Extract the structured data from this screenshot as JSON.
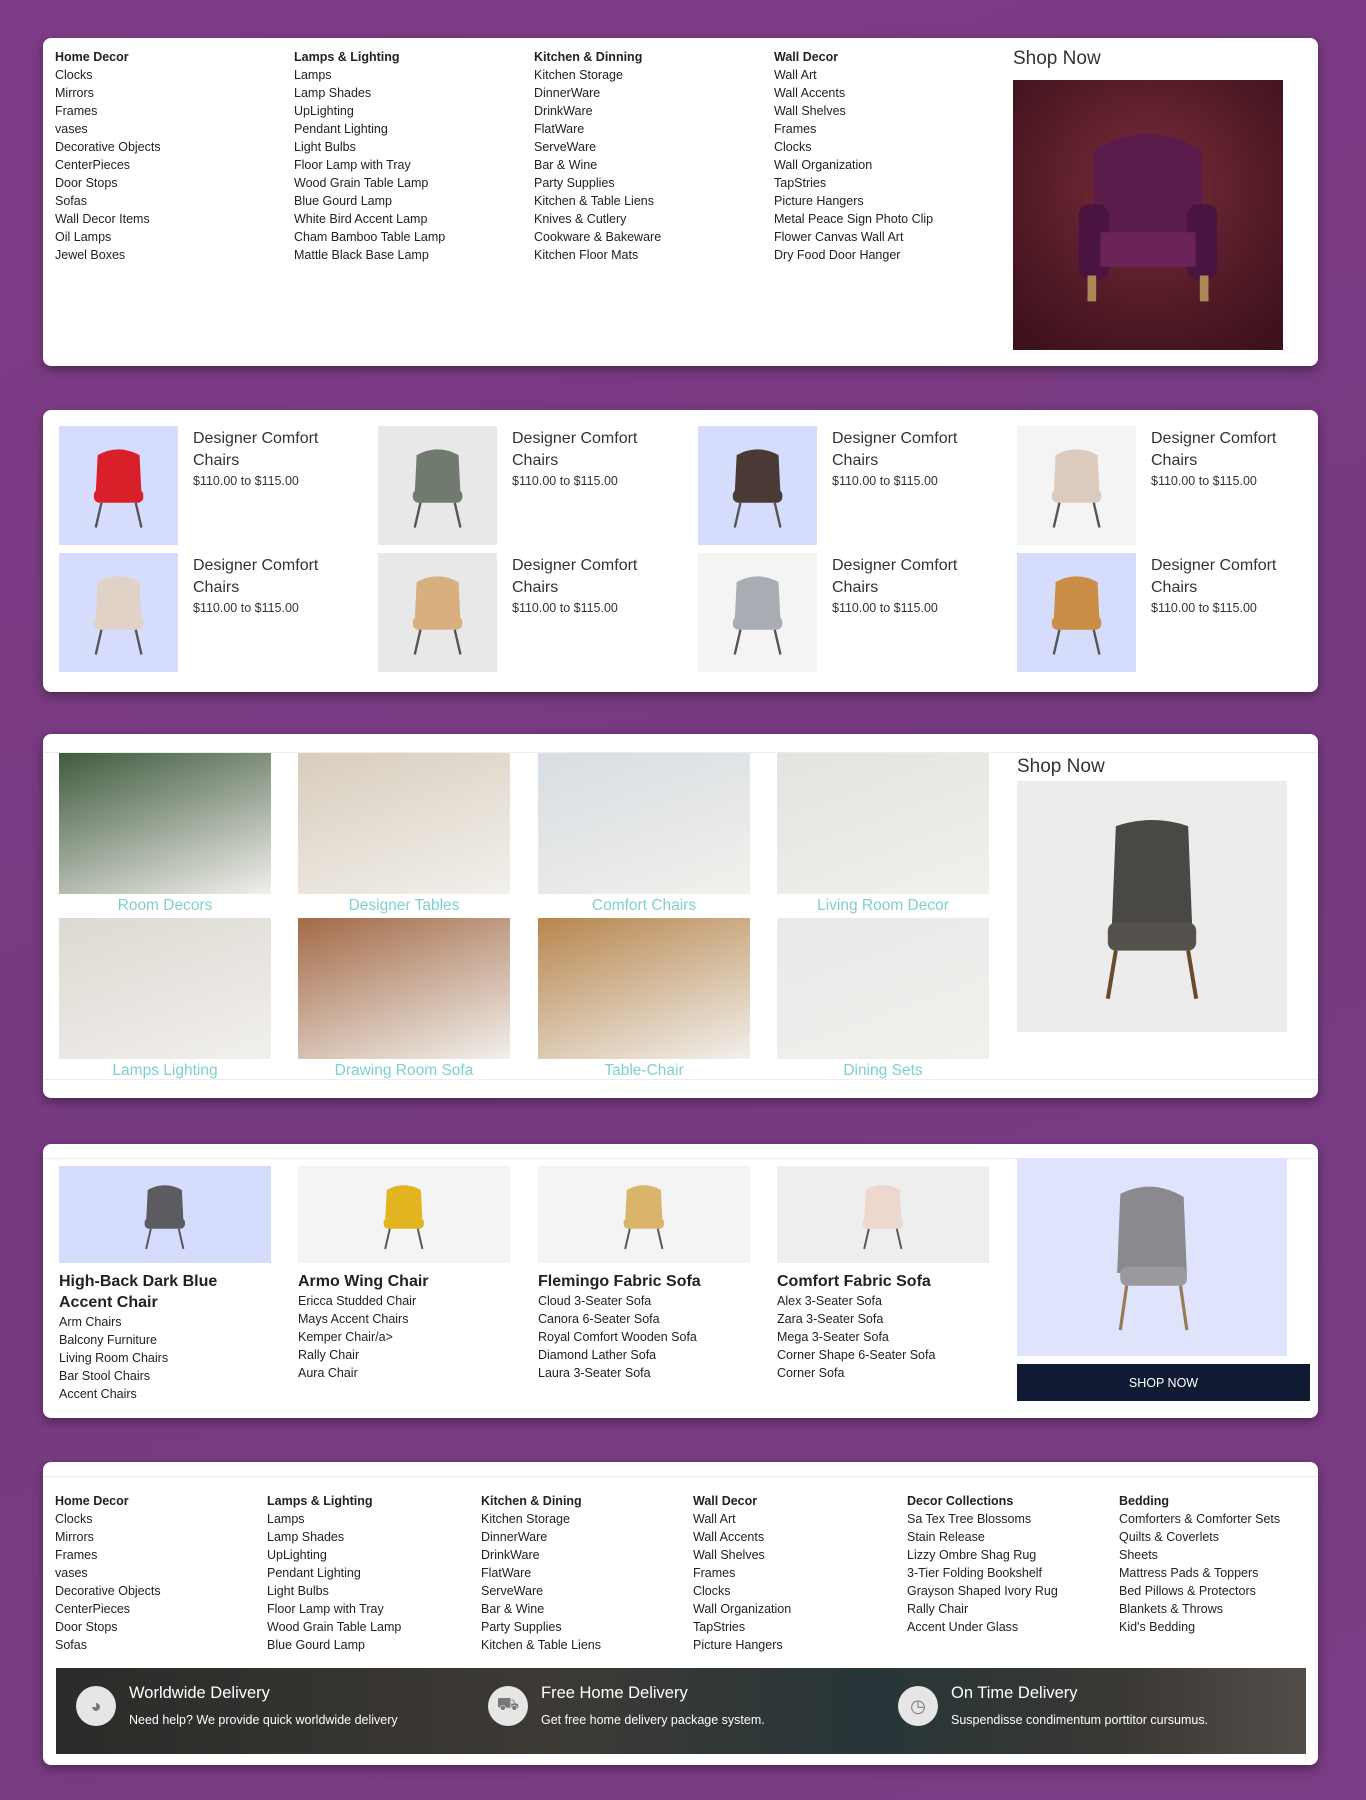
{
  "menu": {
    "columns": [
      {
        "title": "Home Decor",
        "items": [
          "Clocks",
          "Mirrors",
          "Frames",
          "vases",
          "Decorative Objects",
          "CenterPieces",
          "Door Stops",
          "Sofas",
          "Wall Decor Items",
          "Oil Lamps",
          "Jewel Boxes"
        ]
      },
      {
        "title": "Lamps & Lighting",
        "items": [
          "Lamps",
          "Lamp Shades",
          "UpLighting",
          "Pendant Lighting",
          "Light Bulbs",
          "Floor Lamp with Tray",
          "Wood Grain Table Lamp",
          "Blue Gourd Lamp",
          "White Bird Accent Lamp",
          "Cham Bamboo Table Lamp",
          "Mattle Black Base Lamp"
        ]
      },
      {
        "title": "Kitchen & Dinning",
        "items": [
          "Kitchen Storage",
          "DinnerWare",
          "DrinkWare",
          "FlatWare",
          "ServeWare",
          "Bar & Wine",
          "Party Supplies",
          "Kitchen & Table Liens",
          "Knives & Cutlery",
          "Cookware & Bakeware",
          "Kitchen Floor Mats"
        ]
      },
      {
        "title": "Wall Decor",
        "items": [
          "Wall Art",
          "Wall Accents",
          "Wall Shelves",
          "Frames",
          "Clocks",
          "Wall Organization",
          "TapStries",
          "Picture Hangers",
          "Metal Peace Sign Photo Clip",
          "Flower Canvas Wall Art",
          "Dry Food Door Hanger"
        ]
      }
    ],
    "shop_now": "Shop Now"
  },
  "products": [
    {
      "title": "Designer Comfort Chairs",
      "price": "$110.00 to $115.00",
      "bg": "#d6dcfb",
      "color": "#d9202a"
    },
    {
      "title": "Designer Comfort Chairs",
      "price": "$110.00 to $115.00",
      "bg": "#e8e8e8",
      "color": "#707a6e"
    },
    {
      "title": "Designer Comfort Chairs",
      "price": "$110.00 to $115.00",
      "bg": "#d6dcfb",
      "color": "#4a3a36"
    },
    {
      "title": "Designer Comfort Chairs",
      "price": "$110.00 to $115.00",
      "bg": "#f4f4f4",
      "color": "#dccbbd"
    },
    {
      "title": "Designer Comfort Chairs",
      "price": "$110.00 to $115.00",
      "bg": "#d6dcfb",
      "color": "#e0d2c6"
    },
    {
      "title": "Designer Comfort Chairs",
      "price": "$110.00 to $115.00",
      "bg": "#e8e8e8",
      "color": "#d8b080"
    },
    {
      "title": "Designer Comfort Chairs",
      "price": "$110.00 to $115.00",
      "bg": "#f4f4f4",
      "color": "#a8adb3"
    },
    {
      "title": "Designer Comfort Chairs",
      "price": "$110.00 to $115.00",
      "bg": "#d6dcfb",
      "color": "#c98d45"
    }
  ],
  "gallery": {
    "tiles": [
      {
        "label": "Room Decors",
        "bg": "#3f5a3e"
      },
      {
        "label": "Designer Tables",
        "bg": "#d8cdbd"
      },
      {
        "label": "Comfort Chairs",
        "bg": "#d7dde2"
      },
      {
        "label": "Living Room Decor",
        "bg": "#e4e3e0"
      },
      {
        "label": "Lamps Lighting",
        "bg": "#dcd9d2"
      },
      {
        "label": "Drawing Room Sofa",
        "bg": "#a36a47"
      },
      {
        "label": "Table-Chair",
        "bg": "#b7864e"
      },
      {
        "label": "Dining Sets",
        "bg": "#e9e9e9"
      }
    ],
    "shop_now": "Shop Now"
  },
  "categories": {
    "items": [
      {
        "title": "High-Back Dark Blue Accent Chair",
        "bg": "#d6dcfb",
        "links": [
          "Arm Chairs",
          "Balcony Furniture",
          "Living Room Chairs",
          "Bar Stool Chairs",
          "Accent Chairs"
        ]
      },
      {
        "title": "Armo Wing Chair",
        "bg": "#f4f4f4",
        "links": [
          "Ericca Studded Chair",
          "Mays Accent Chairs",
          "Kemper Chair/a>",
          "Rally Chair",
          "Aura Chair"
        ]
      },
      {
        "title": "Flemingo Fabric Sofa",
        "bg": "#f4f4f4",
        "links": [
          "Cloud 3-Seater Sofa",
          "Canora 6-Seater Sofa",
          "Royal Comfort Wooden Sofa",
          "Diamond Lather Sofa",
          "Laura 3-Seater Sofa"
        ]
      },
      {
        "title": "Comfort Fabric Sofa",
        "bg": "#eeeeee",
        "links": [
          "Alex 3-Seater Sofa",
          "Zara 3-Seater Sofa",
          "Mega 3-Seater Sofa",
          "Corner Shape 6-Seater Sofa",
          "Corner Sofa"
        ]
      }
    ],
    "shop_button": "SHOP NOW"
  },
  "footer": {
    "columns": [
      {
        "title": "Home Decor",
        "items": [
          "Clocks",
          "Mirrors",
          "Frames",
          "vases",
          "Decorative Objects",
          "CenterPieces",
          "Door Stops",
          "Sofas"
        ]
      },
      {
        "title": "Lamps & Lighting",
        "items": [
          "Lamps",
          "Lamp Shades",
          "UpLighting",
          "Pendant Lighting",
          "Light Bulbs",
          "Floor Lamp with Tray",
          "Wood Grain Table Lamp",
          "Blue Gourd Lamp"
        ]
      },
      {
        "title": "Kitchen & Dining",
        "items": [
          "Kitchen Storage",
          "DinnerWare",
          "DrinkWare",
          "FlatWare",
          "ServeWare",
          "Bar & Wine",
          "Party Supplies",
          "Kitchen & Table Liens"
        ]
      },
      {
        "title": "Wall Decor",
        "items": [
          "Wall Art",
          "Wall Accents",
          "Wall Shelves",
          "Frames",
          "Clocks",
          "Wall Organization",
          "TapStries",
          "Picture Hangers"
        ]
      },
      {
        "title": "Decor Collections",
        "items": [
          "Sa Tex Tree Blossoms",
          "Stain Release",
          "Lizzy Ombre Shag Rug",
          "3-Tier Folding Bookshelf",
          "Grayson Shaped Ivory Rug",
          "Rally Chair",
          "Accent Under Glass"
        ]
      },
      {
        "title": "Bedding",
        "items": [
          "Comforters & Comforter Sets",
          "Quilts & Coverlets",
          "Sheets",
          "Mattress Pads & Toppers",
          "Bed Pillows & Protectors",
          "Blankets & Throws",
          "Kid's Bedding"
        ]
      }
    ],
    "features": [
      {
        "icon": "globe-icon",
        "glyph": "◕",
        "title": "Worldwide Delivery",
        "text": "Need help? We provide quick worldwide delivery"
      },
      {
        "icon": "truck-icon",
        "glyph": "⛟",
        "title": "Free Home Delivery",
        "text": "Get free home delivery package system."
      },
      {
        "icon": "clock-icon",
        "glyph": "◷",
        "title": "On Time Delivery",
        "text": "Suspendisse condimentum porttitor cursumus."
      }
    ]
  }
}
